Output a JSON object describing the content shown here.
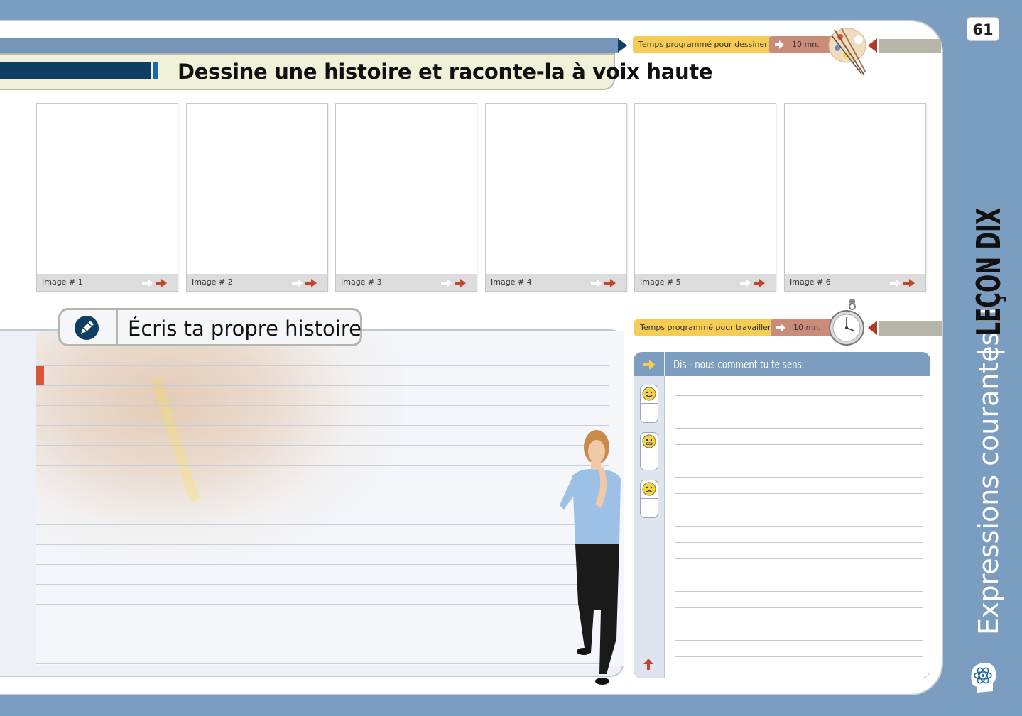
{
  "page_number": "61",
  "title": "Dessine une histoire et raconte-la à voix haute",
  "draw_timer": {
    "label": "Temps programmé pour dessiner",
    "duration": "10 mn.",
    "icon": "palette-icon"
  },
  "frames": [
    {
      "label": "Image # 1"
    },
    {
      "label": "Image # 2"
    },
    {
      "label": "Image # 3"
    },
    {
      "label": "Image # 4"
    },
    {
      "label": "Image # 5"
    },
    {
      "label": "Image # 6"
    }
  ],
  "write_section": {
    "title": "Écris ta propre histoire",
    "icon": "pen-icon"
  },
  "work_timer": {
    "label": "Temps programmé pour travailler:",
    "duration": "10 mn.",
    "icon": "stopwatch-icon"
  },
  "feelings_panel": {
    "title": "Dis - nous comment tu te sens.",
    "moods": [
      "happy-face-icon",
      "neutral-face-icon",
      "sad-face-icon"
    ]
  },
  "sidebar": {
    "subject": "Expressions courantes II",
    "separator": "|",
    "lesson": "LEÇON DIX",
    "icon": "atom-head-icon"
  },
  "colors": {
    "background_blue": "#7b9dbf",
    "navy": "#0e3f63",
    "timer_yellow": "#f6cc55",
    "timer_rust": "#c98c78",
    "accent_red": "#b33a26"
  }
}
